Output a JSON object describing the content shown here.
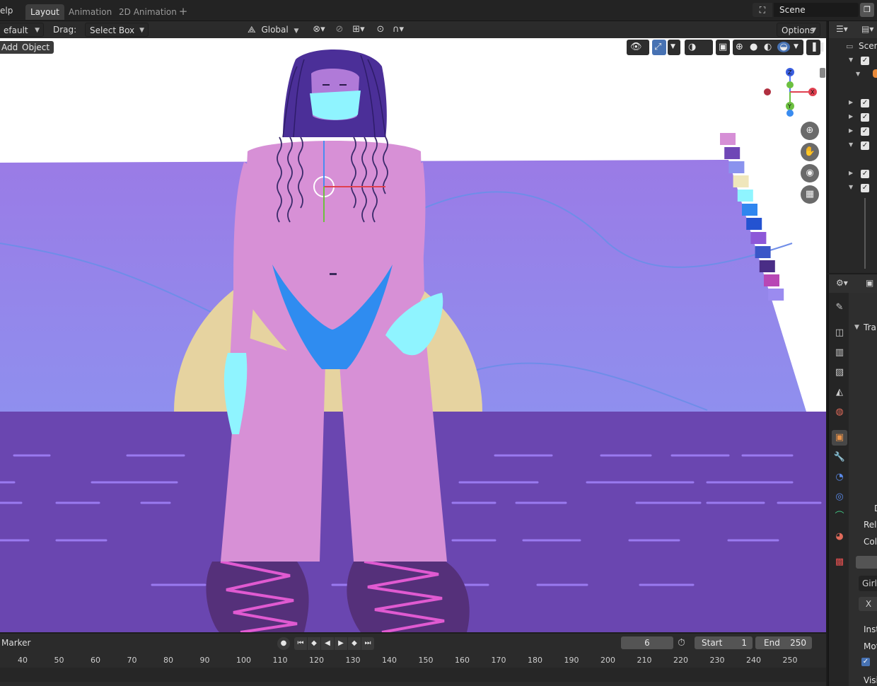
{
  "topbar": {
    "help_menu": "elp",
    "tabs": [
      {
        "label": "Layout",
        "active": true
      },
      {
        "label": "Animation",
        "active": false
      },
      {
        "label": "2D Animation",
        "active": false
      }
    ],
    "add_tab": "+",
    "scene_name": "Scene"
  },
  "viewport_header": {
    "mode_dropdown": "efault",
    "drag_label": "Drag:",
    "drag_value": "Select Box",
    "orientation": "Global",
    "options": "Options"
  },
  "viewport": {
    "menu_add": "Add",
    "menu_object": "Object",
    "gizmo_axes": {
      "z": "Z",
      "y": "Y",
      "x": "X"
    },
    "palette_colors": [
      "#d68fd6",
      "#6f46b6",
      "#8a93ee",
      "#efe6bb",
      "#8ff5ff",
      "#2f86ef",
      "#2453d1",
      "#8d57d8",
      "#3a56c8",
      "#4a2d86",
      "#b847b5",
      "#9b8bf0"
    ],
    "colors": {
      "sky": "#9684e6",
      "water": "#6a46b0",
      "sun": "#e6d3a0",
      "skin": "#d790d6",
      "mask": "#8ff4ff",
      "bikini": "#2f8cf0",
      "hair": "#4b2f98",
      "ripples": "#e05ad1"
    }
  },
  "outliner": {
    "header_label": "Scen"
  },
  "properties": {
    "transform": "Tra",
    "delta": "D",
    "relations": "Rela",
    "collections": "Coll",
    "collection_name": "Girl-",
    "x_label": "X",
    "instancing": "Insti",
    "motion": "Moti",
    "visibility": "Visi"
  },
  "timeline": {
    "marker": "Marker",
    "current_frame": "6",
    "start_label": "Start",
    "start_value": "1",
    "end_label": "End",
    "end_value": "250",
    "ruler": [
      "40",
      "50",
      "60",
      "70",
      "80",
      "90",
      "100",
      "110",
      "120",
      "130",
      "140",
      "150",
      "160",
      "170",
      "180",
      "190",
      "200",
      "210",
      "220",
      "230",
      "240",
      "250"
    ]
  }
}
